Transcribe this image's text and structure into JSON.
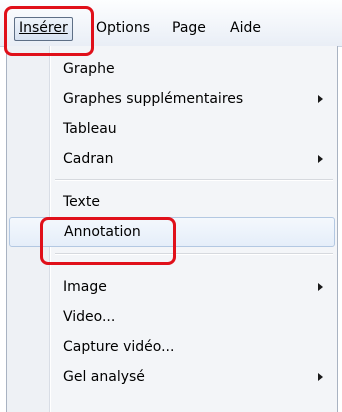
{
  "menubar": {
    "items": [
      {
        "label": "Insérer",
        "active": true
      },
      {
        "label": "Options"
      },
      {
        "label": "Page"
      },
      {
        "label": "Aide"
      }
    ]
  },
  "menu": {
    "items": [
      {
        "label": "Graphe",
        "submenu": false
      },
      {
        "label": "Graphes supplémentaires",
        "submenu": true
      },
      {
        "label": "Tableau",
        "submenu": false
      },
      {
        "label": "Cadran",
        "submenu": true
      },
      {
        "label": "Texte",
        "submenu": false
      },
      {
        "label": "Annotation",
        "submenu": false,
        "highlighted": true
      },
      {
        "label": "Image",
        "submenu": true
      },
      {
        "label": "Video...",
        "submenu": false
      },
      {
        "label": "Capture vidéo...",
        "submenu": false
      },
      {
        "label": "Gel analysé",
        "submenu": true
      }
    ]
  },
  "colors": {
    "callout": "#e0101a",
    "hover_border": "#b3c8e2"
  }
}
